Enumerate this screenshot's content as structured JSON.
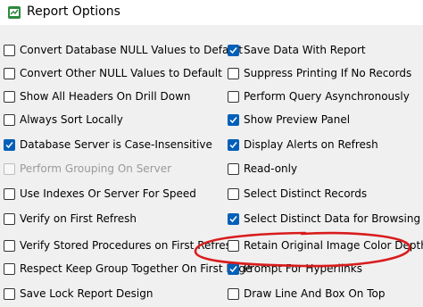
{
  "window": {
    "title": "Report Options"
  },
  "options": [
    {
      "id": "convert-db-null",
      "label": "Convert Database NULL Values to Default",
      "checked": false,
      "disabled": false
    },
    {
      "id": "convert-other-null",
      "label": "Convert Other NULL Values to Default",
      "checked": false,
      "disabled": false
    },
    {
      "id": "show-all-headers",
      "label": "Show All Headers On Drill Down",
      "checked": false,
      "disabled": false
    },
    {
      "id": "always-sort-locally",
      "label": "Always Sort Locally",
      "checked": false,
      "disabled": false
    },
    {
      "id": "db-case-insensitive",
      "label": "Database Server is Case-Insensitive",
      "checked": true,
      "disabled": false
    },
    {
      "id": "grouping-on-server",
      "label": "Perform Grouping On Server",
      "checked": false,
      "disabled": true
    },
    {
      "id": "use-indexes",
      "label": "Use Indexes Or Server For Speed",
      "checked": false,
      "disabled": false
    },
    {
      "id": "verify-first-refresh",
      "label": "Verify on First Refresh",
      "checked": false,
      "disabled": false
    },
    {
      "id": "verify-stored-procs",
      "label": "Verify Stored Procedures on First Refresh",
      "checked": false,
      "disabled": false
    },
    {
      "id": "respect-keep-group",
      "label": "Respect Keep Group Together On First Page",
      "checked": false,
      "disabled": false
    },
    {
      "id": "save-lock-design",
      "label": "Save Lock Report Design",
      "checked": false,
      "disabled": false
    },
    {
      "id": "save-data",
      "label": "Save Data With Report",
      "checked": true,
      "disabled": false
    },
    {
      "id": "suppress-printing",
      "label": "Suppress Printing If No Records",
      "checked": false,
      "disabled": false
    },
    {
      "id": "query-async",
      "label": "Perform Query Asynchronously",
      "checked": false,
      "disabled": false
    },
    {
      "id": "show-preview-panel",
      "label": "Show Preview Panel",
      "checked": true,
      "disabled": false
    },
    {
      "id": "display-alerts",
      "label": "Display Alerts on Refresh",
      "checked": true,
      "disabled": false
    },
    {
      "id": "read-only",
      "label": "Read-only",
      "checked": false,
      "disabled": false
    },
    {
      "id": "select-distinct-records",
      "label": "Select Distinct Records",
      "checked": false,
      "disabled": false
    },
    {
      "id": "select-distinct-browsing",
      "label": "Select Distinct Data for Browsing",
      "checked": true,
      "disabled": false
    },
    {
      "id": "retain-image-color-depth",
      "label": "Retain Original Image Color Depth",
      "checked": false,
      "disabled": false
    },
    {
      "id": "prompt-hyperlinks",
      "label": "Prompt For Hyperlinks",
      "checked": true,
      "disabled": false
    },
    {
      "id": "draw-line-box-on-top",
      "label": "Draw Line And Box On Top",
      "checked": false,
      "disabled": false
    }
  ],
  "colors": {
    "checkbox_checked": "#005fb8",
    "annotation_ellipse": "#d91c1c",
    "disabled_text": "#9a9a9a"
  },
  "icons": {
    "app": "report-options-app-icon",
    "check": "checkmark-icon"
  }
}
